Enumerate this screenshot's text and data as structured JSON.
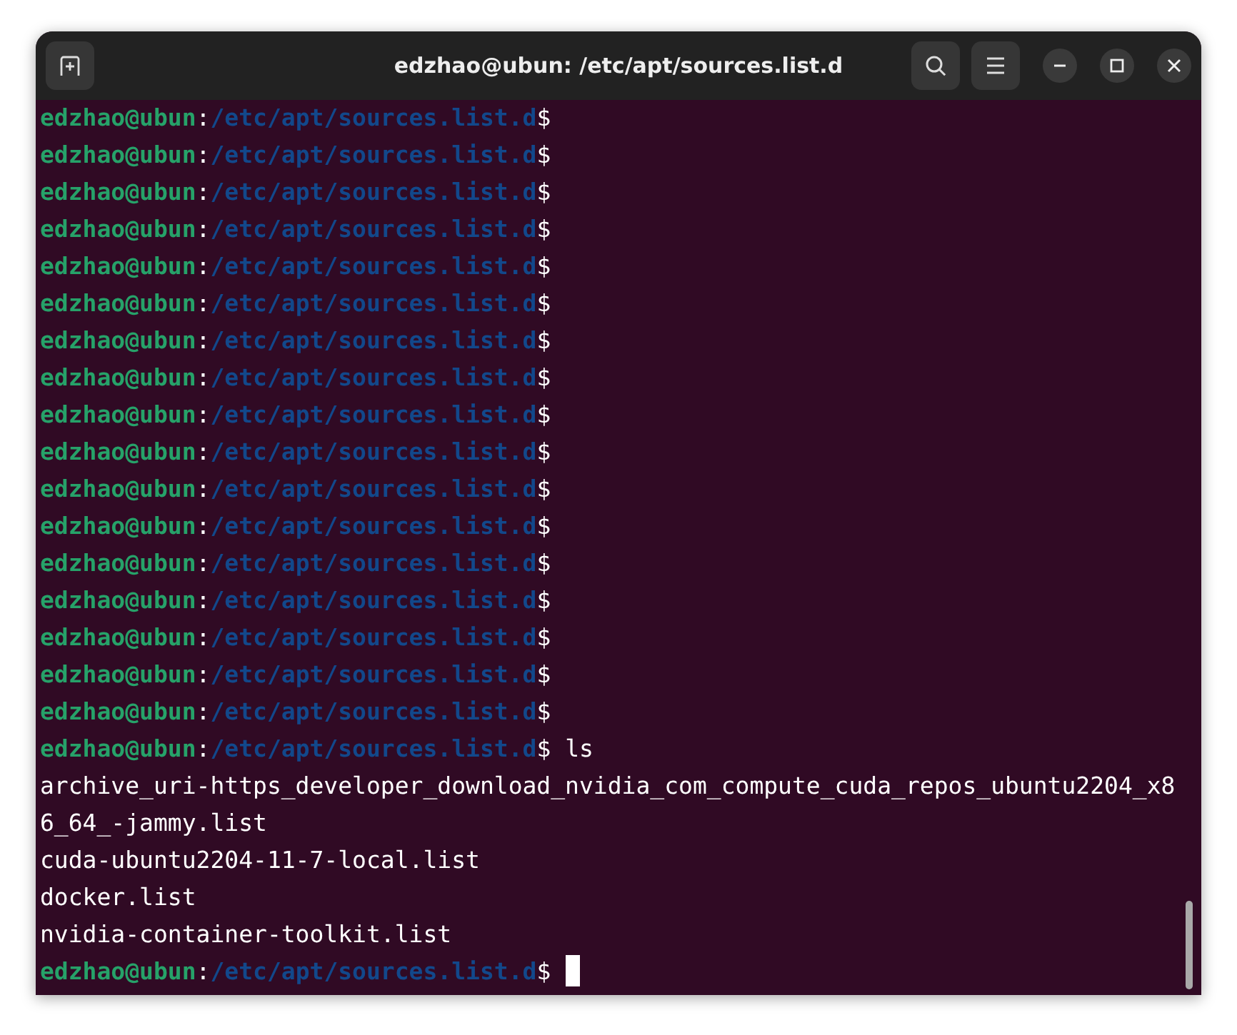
{
  "window": {
    "title": "edzhao@ubun: /etc/apt/sources.list.d"
  },
  "lines": [
    {
      "kind": "prompt",
      "user": "edzhao@ubun",
      "separator": ":",
      "path": "/etc/apt/sources.list.d",
      "symbol": "$"
    },
    {
      "kind": "prompt",
      "user": "edzhao@ubun",
      "separator": ":",
      "path": "/etc/apt/sources.list.d",
      "symbol": "$"
    },
    {
      "kind": "prompt",
      "user": "edzhao@ubun",
      "separator": ":",
      "path": "/etc/apt/sources.list.d",
      "symbol": "$"
    },
    {
      "kind": "prompt",
      "user": "edzhao@ubun",
      "separator": ":",
      "path": "/etc/apt/sources.list.d",
      "symbol": "$"
    },
    {
      "kind": "prompt",
      "user": "edzhao@ubun",
      "separator": ":",
      "path": "/etc/apt/sources.list.d",
      "symbol": "$"
    },
    {
      "kind": "prompt",
      "user": "edzhao@ubun",
      "separator": ":",
      "path": "/etc/apt/sources.list.d",
      "symbol": "$"
    },
    {
      "kind": "prompt",
      "user": "edzhao@ubun",
      "separator": ":",
      "path": "/etc/apt/sources.list.d",
      "symbol": "$"
    },
    {
      "kind": "prompt",
      "user": "edzhao@ubun",
      "separator": ":",
      "path": "/etc/apt/sources.list.d",
      "symbol": "$"
    },
    {
      "kind": "prompt",
      "user": "edzhao@ubun",
      "separator": ":",
      "path": "/etc/apt/sources.list.d",
      "symbol": "$"
    },
    {
      "kind": "prompt",
      "user": "edzhao@ubun",
      "separator": ":",
      "path": "/etc/apt/sources.list.d",
      "symbol": "$"
    },
    {
      "kind": "prompt",
      "user": "edzhao@ubun",
      "separator": ":",
      "path": "/etc/apt/sources.list.d",
      "symbol": "$"
    },
    {
      "kind": "prompt",
      "user": "edzhao@ubun",
      "separator": ":",
      "path": "/etc/apt/sources.list.d",
      "symbol": "$"
    },
    {
      "kind": "prompt",
      "user": "edzhao@ubun",
      "separator": ":",
      "path": "/etc/apt/sources.list.d",
      "symbol": "$"
    },
    {
      "kind": "prompt",
      "user": "edzhao@ubun",
      "separator": ":",
      "path": "/etc/apt/sources.list.d",
      "symbol": "$"
    },
    {
      "kind": "prompt",
      "user": "edzhao@ubun",
      "separator": ":",
      "path": "/etc/apt/sources.list.d",
      "symbol": "$"
    },
    {
      "kind": "prompt",
      "user": "edzhao@ubun",
      "separator": ":",
      "path": "/etc/apt/sources.list.d",
      "symbol": "$"
    },
    {
      "kind": "prompt",
      "user": "edzhao@ubun",
      "separator": ":",
      "path": "/etc/apt/sources.list.d",
      "symbol": "$"
    },
    {
      "kind": "prompt",
      "user": "edzhao@ubun",
      "separator": ":",
      "path": "/etc/apt/sources.list.d",
      "symbol": "$",
      "command": "ls"
    },
    {
      "kind": "output",
      "text": "archive_uri-https_developer_download_nvidia_com_compute_cuda_repos_ubuntu2204_x86_64_-jammy.list"
    },
    {
      "kind": "output",
      "text": "cuda-ubuntu2204-11-7-local.list"
    },
    {
      "kind": "output",
      "text": "docker.list"
    },
    {
      "kind": "output",
      "text": "nvidia-container-toolkit.list"
    },
    {
      "kind": "prompt",
      "user": "edzhao@ubun",
      "separator": ":",
      "path": "/etc/apt/sources.list.d",
      "symbol": "$",
      "cursor": true
    }
  ]
}
